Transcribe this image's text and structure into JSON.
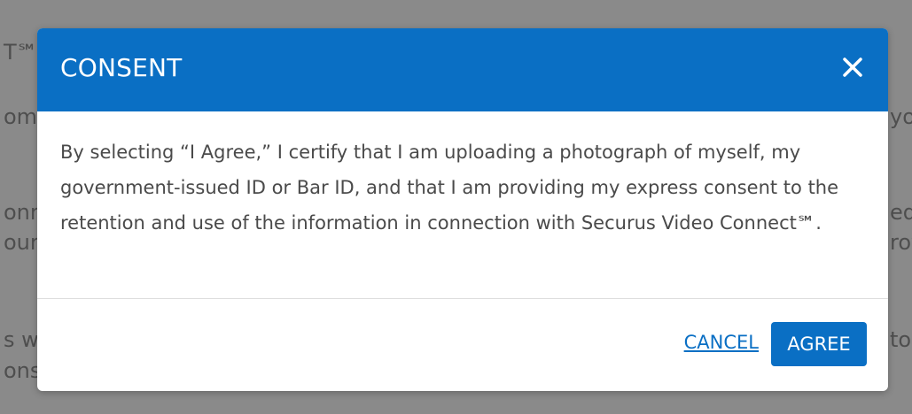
{
  "background": {
    "fragments": [
      "T℠",
      "om",
      "onr",
      "our",
      "s w",
      "ons",
      "you",
      "ed",
      "rov",
      "to"
    ]
  },
  "modal": {
    "title": "CONSENT",
    "close_icon": "close-icon",
    "body_text": "By selecting “I Agree,” I certify that I am uploading a photograph of myself, my government-issued ID or Bar ID, and that I am providing my express consent to the retention and use of the information in connection with Securus Video Connect℠.",
    "cancel_label": "CANCEL",
    "agree_label": "AGREE"
  },
  "colors": {
    "accent": "#0a6fc4",
    "overlay": "#8a8a8a",
    "text": "#4a4a4a"
  }
}
